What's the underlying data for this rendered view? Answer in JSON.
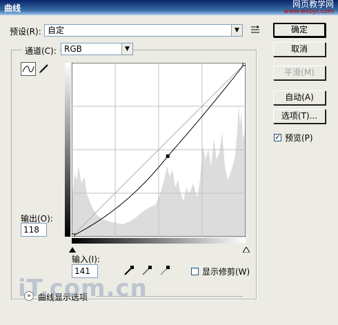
{
  "window": {
    "title": "曲线",
    "watermark": "网页教学网",
    "watermark_url": "www.webjx.com"
  },
  "preset": {
    "label": "预设(R):",
    "value": "自定"
  },
  "channel": {
    "label": "通道(C):",
    "value": "RGB"
  },
  "output": {
    "label": "输出(O):",
    "value": "118"
  },
  "input": {
    "label": "输入(I):",
    "value": "141"
  },
  "show_clipping": {
    "label": "显示修剪(W)",
    "checked": false
  },
  "curve_display_options": "曲线显示选项",
  "buttons": {
    "ok": "确定",
    "cancel": "取消",
    "smooth": "平滑(M)",
    "auto": "自动(A)",
    "options": "选项(T)...",
    "preview": "预览(P)"
  },
  "preview_checked": true,
  "logo_text": "iT.com.cn",
  "chart_data": {
    "type": "line",
    "title": "",
    "xlim": [
      0,
      255
    ],
    "ylim": [
      0,
      255
    ],
    "series": [
      {
        "name": "",
        "x": [
          0,
          141,
          255
        ],
        "y": [
          0,
          118,
          255
        ]
      }
    ],
    "control_points": [
      [
        0,
        0
      ],
      [
        141,
        118
      ],
      [
        255,
        255
      ]
    ],
    "baseline_diagonal": true,
    "grid": "4x4"
  }
}
